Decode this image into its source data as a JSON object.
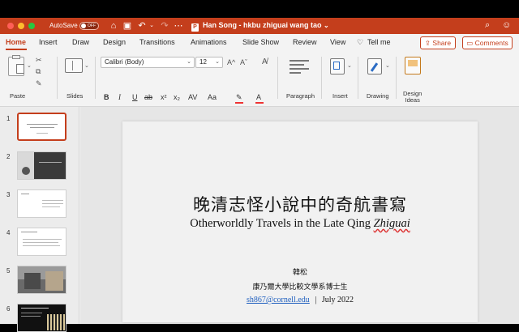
{
  "titlebar": {
    "autosave_label": "AutoSave",
    "autosave_state": "OFF",
    "document_title": "Han Song - hkbu zhiguai wang tao",
    "dropdown_glyph": "⌄"
  },
  "tabs": [
    "Home",
    "Insert",
    "Draw",
    "Design",
    "Transitions",
    "Animations",
    "Slide Show",
    "Review",
    "View",
    "Tell me"
  ],
  "active_tab": "Home",
  "share_label": "Share",
  "comments_label": "Comments",
  "ribbon": {
    "paste_label": "Paste",
    "slides_label": "Slides",
    "font_name": "Calibri (Body)",
    "font_size": "12",
    "paragraph_label": "Paragraph",
    "insert_label": "Insert",
    "drawing_label": "Drawing",
    "design_ideas_label_1": "Design",
    "design_ideas_label_2": "Ideas",
    "bold": "B",
    "italic": "I",
    "underline": "U",
    "strike": "ab",
    "superscript": "x²",
    "subscript": "x₂",
    "spacing": "AV",
    "case": "Aa",
    "grow_font": "A^",
    "shrink_font": "Aˇ"
  },
  "thumbnails": [
    {
      "num": "1",
      "selected": true
    },
    {
      "num": "2",
      "selected": false
    },
    {
      "num": "3",
      "selected": false
    },
    {
      "num": "4",
      "selected": false
    },
    {
      "num": "5",
      "selected": false
    },
    {
      "num": "6",
      "selected": false
    }
  ],
  "slide": {
    "title_zh": "晚清志怪小說中的奇航書寫",
    "title_en_prefix": "Otherworldly Travels in the Late Qing ",
    "title_en_italic": "Zhiguai",
    "author": "韓松",
    "affiliation": "康乃爾大學比較文學系博士生",
    "email": "sh867@cornell.edu",
    "separator": "|",
    "date": "July 2022"
  },
  "colors": {
    "accent": "#c43e1c",
    "link": "#1f5fbf"
  }
}
